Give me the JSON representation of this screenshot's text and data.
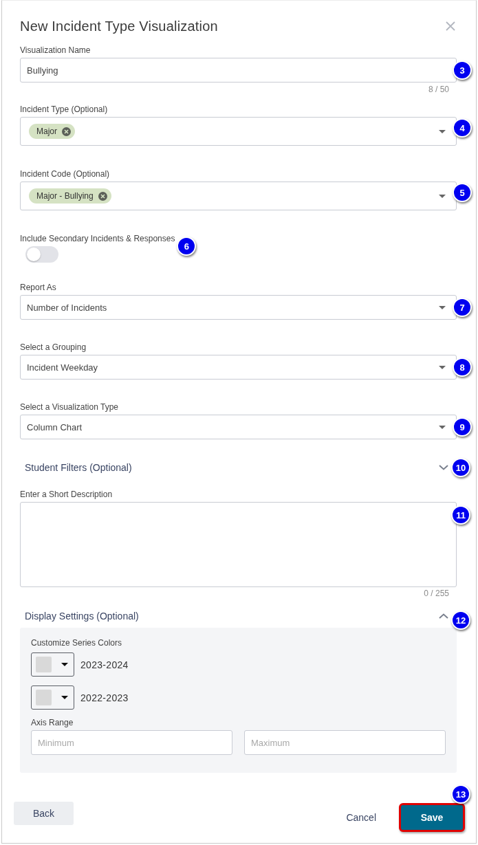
{
  "dialog": {
    "title": "New Incident Type Visualization"
  },
  "fields": [
    {
      "kind": "text",
      "label": "Visualization Name",
      "value": "Bullying",
      "counter": "8 / 50",
      "callout": "3"
    },
    {
      "kind": "multiselect",
      "label": "Incident Type (Optional)",
      "chips": [
        "Major"
      ],
      "callout": "4"
    },
    {
      "kind": "multiselect",
      "label": "Incident Code (Optional)",
      "chips": [
        "Major - Bullying"
      ],
      "callout": "5"
    },
    {
      "kind": "toggle",
      "label": "Include Secondary Incidents & Responses",
      "on": false,
      "callout": "6"
    },
    {
      "kind": "select",
      "label": "Report As",
      "value": "Number of Incidents",
      "callout": "7"
    },
    {
      "kind": "select",
      "label": "Select a Grouping",
      "value": "Incident Weekday",
      "callout": "8"
    },
    {
      "kind": "select",
      "label": "Select a Visualization Type",
      "value": "Column Chart",
      "callout": "9"
    },
    {
      "kind": "section",
      "title": "Student Filters (Optional)",
      "expanded": false,
      "callout": "10"
    },
    {
      "kind": "textarea",
      "label": "Enter a Short Description",
      "counter": "0 / 255",
      "callout": "11"
    },
    {
      "kind": "section",
      "title": "Display Settings (Optional)",
      "expanded": true,
      "callout": "12",
      "panel": {
        "colors_label": "Customize Series Colors",
        "series": [
          {
            "name": "2023-2024",
            "color": "#d9d9d9"
          },
          {
            "name": "2022-2023",
            "color": "#d9d9d9"
          }
        ],
        "axis_label": "Axis Range",
        "axis_fields": [
          {
            "placeholder": "Minimum"
          },
          {
            "placeholder": "Maximum"
          }
        ]
      }
    }
  ],
  "footer": {
    "buttons": [
      {
        "kind": "secondary",
        "label": "Back",
        "highlighted": false
      },
      {
        "kind": "text",
        "label": "Cancel",
        "highlighted": false
      },
      {
        "kind": "primary",
        "label": "Save",
        "highlighted": true,
        "callout": "13"
      }
    ]
  }
}
